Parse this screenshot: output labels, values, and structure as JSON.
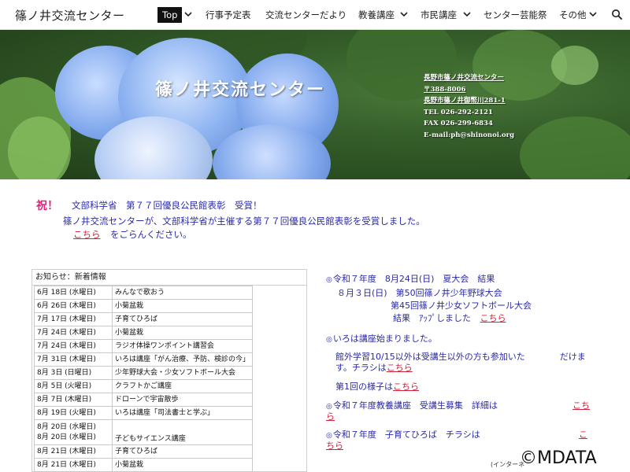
{
  "header": {
    "site_title": "篠ノ井交流センター",
    "nav": [
      {
        "label": "Top",
        "active": true,
        "dropdown": true
      },
      {
        "label": "行事予定表",
        "active": false,
        "dropdown": false
      },
      {
        "label": "交流センターだより",
        "active": false,
        "dropdown": false
      },
      {
        "label": "教養講座",
        "active": false,
        "dropdown": true
      },
      {
        "label": "市民講座",
        "active": false,
        "dropdown": true
      },
      {
        "label": "センター芸能祭",
        "active": false,
        "dropdown": false
      },
      {
        "label": "その他",
        "active": false,
        "dropdown": true
      }
    ],
    "search_icon": "search-icon"
  },
  "hero": {
    "title": "篠ノ井交流センター",
    "info": [
      "長野市篠ノ井交流センター",
      "〒388-8006",
      "長野市篠ノ井御幣川281-1",
      "TEL 026-292-2121",
      "FAX 026-299-6834",
      "E-mail:ph@shinonoi.org"
    ]
  },
  "announcement": {
    "lead": "祝！",
    "headline": "文部科学省　第７７回優良公民館表彰　受賞！",
    "body": "篠ノ井交流センターが、文部科学省が主催する第７７回優良公民館表彰を受賞しました。",
    "link": "こちら",
    "tail": "をごらんください。"
  },
  "news": {
    "title": "お知らせ：新着情報",
    "rows": [
      {
        "date": "6月 18日 (水曜日)",
        "event": "みんなで歌おう"
      },
      {
        "date": "6月 26日 (木曜日)",
        "event": "小菊盆栽"
      },
      {
        "date": "7月 17日 (木曜日)",
        "event": "子育てひろば"
      },
      {
        "date": "7月 24日 (木曜日)",
        "event": "小菊盆栽"
      },
      {
        "date": "7月 24日 (木曜日)",
        "event": "ラジオ体操ワンポイント講習会"
      },
      {
        "date": "7月 31日 (木曜日)",
        "event": "いろは講座「がん治療、予防、検診の今」"
      },
      {
        "date": "8月 3日 (日曜日)",
        "event": "少年野球大会・少女ソフトボール大会"
      },
      {
        "date": "8月 5日 (火曜日)",
        "event": "クラフトかご講座"
      },
      {
        "date": "8月 7日 (木曜日)",
        "event": "ドローンで宇宙散歩"
      },
      {
        "date": "8月 19日 (火曜日)",
        "event": "いろは講座「司法書士と学ぶ」"
      },
      {
        "date": "8月 20日 (水曜日)",
        "date2": "8月 20日 (水曜日)",
        "event": "子どもサイエンス講座"
      },
      {
        "date": "8月 21日 (木曜日)",
        "event": "子育てひろば"
      },
      {
        "date": "8月 21日 (木曜日)",
        "event": "小菊盆栽"
      }
    ]
  },
  "right": {
    "p1_mark": "◎",
    "p1_title": "令和７年度　8月24日(日)　夏大会　結果",
    "p1_line2": "８月３日(日)　第50回篠ノ井少年野球大会",
    "p1_line3": "第45回篠ノ井少女ソフトボール大会",
    "p1_line4": "結果　ｱｯﾌﾟしました",
    "p1_link": "こちら",
    "p2_mark": "◎",
    "p2_title": "いろは講座始まりました。",
    "p2_line2": "館外学習10/15以外は受講生以外の方も参加いた　　　　だけま",
    "p2_line3": "す。チラシは",
    "p2_link": "こちら",
    "p2_line4": "第1回の様子は",
    "p2_link2": "こちら",
    "p3_mark": "◎",
    "p3_title": "令和７年度教養講座　受講生募集　詳細は",
    "p3_link_a": "こち",
    "p3_link_b": "ら",
    "p4_mark": "◎",
    "p4_title": "令和７年度　子育てひろば　チラシは",
    "p4_link_a": "こ",
    "p4_link_b": "ちら",
    "p5_small": "(インターネ"
  },
  "watermark": "©MDATA"
}
